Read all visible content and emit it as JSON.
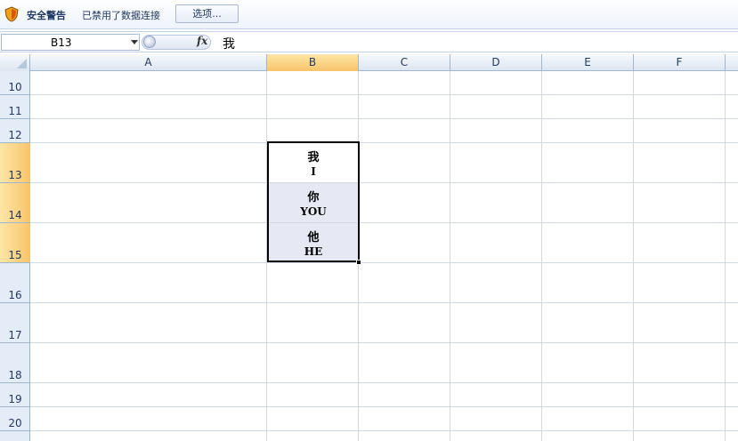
{
  "security_bar": {
    "title": "安全警告",
    "message": "已禁用了数据连接",
    "options_label": "选项..."
  },
  "formula_bar": {
    "name_box": "B13",
    "fx_label": "fx",
    "content": "我"
  },
  "columns": [
    "A",
    "B",
    "C",
    "D",
    "E",
    "F"
  ],
  "rows": [
    "10",
    "11",
    "12",
    "13",
    "14",
    "15",
    "16",
    "17",
    "18",
    "19",
    "20"
  ],
  "selected_column": "B",
  "selected_rows": [
    "13",
    "14",
    "15"
  ],
  "cells": {
    "b13": {
      "line1": "我",
      "line2": "I"
    },
    "b14": {
      "line1": "你",
      "line2": "YOU"
    },
    "b15": {
      "line1": "他",
      "line2": "HE"
    }
  },
  "colors": {
    "accent": "#f8c46a",
    "header_bg": "#e4ecf7",
    "gridline": "#d0d7e5"
  }
}
